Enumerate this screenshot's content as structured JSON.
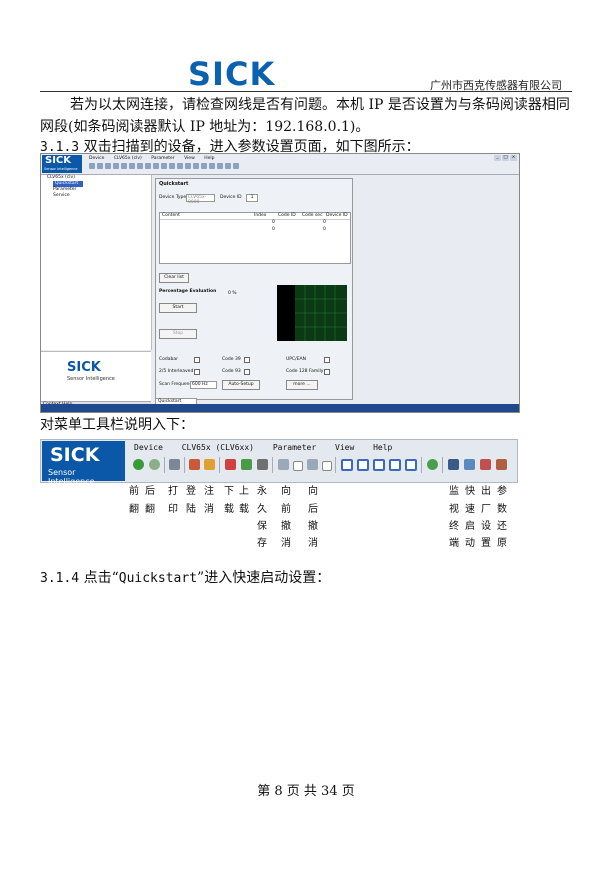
{
  "header": {
    "logo": "SICK",
    "company": "广州市西克传感器有限公司"
  },
  "body": {
    "para1": "若为以太网连接，请检查网线是否有问题。本机 IP 是否设置为与条码阅读器相同网段(如条码阅读器默认 IP 地址为：192.168.0.1)。",
    "sec313_num": "3.1.3",
    "sec313_text": " 双击扫描到的设备，进入参数设置页面，如下图所示：",
    "menu_intro": "对菜单工具栏说明入下：",
    "sec314_num": "3.1.4",
    "sec314_text_a": " 点击“",
    "sec314_mono": "Quickstart",
    "sec314_text_b": "”进入快速启动设置："
  },
  "screenshot": {
    "logo": "SICK",
    "logo_sub": "Sensor Intelligence",
    "menus": [
      "Device",
      "CLV65x (clv)",
      "Parameter",
      "View",
      "Help"
    ],
    "tree": [
      "CLV65x (clv)",
      "Quickstart",
      "Parameter",
      "Service"
    ],
    "panel_title": "Quickstart",
    "device_type_label": "Device Type",
    "device_type_value": "CLV65x-0000",
    "device_id_label": "Device ID",
    "device_id_value": "1",
    "grid_headers": [
      "Content",
      "Index",
      "Code ID",
      "Code sec",
      "Device ID"
    ],
    "grid_rows": [
      [
        "",
        "",
        "0",
        "",
        "0"
      ],
      [
        "",
        "",
        "0",
        "",
        "0"
      ]
    ],
    "clear_list": "Clear list",
    "percentage_eval": "Percentage Evaluation",
    "percent_value": "0 %",
    "start": "Start",
    "stop": "Stop",
    "codes": [
      "Codabar",
      "Code 39",
      "UPC/EAN",
      "2/5 Interleaved",
      "Code 93",
      "Code 128 Family"
    ],
    "scan_freq_label": "Scan Frequency",
    "scan_freq_value": "600 Hz",
    "auto_setup": "Auto-Setup",
    "more": "more ...",
    "context_help": "Context Help",
    "quickstart_tab": "Quickstart"
  },
  "menubar": {
    "logo": "SICK",
    "logo_sub": "Sensor Intelligence.",
    "menus": [
      "Device",
      "CLV65x (CLV6xx)",
      "Parameter",
      "View",
      "Help"
    ]
  },
  "labels": [
    [
      "前",
      "翻"
    ],
    [
      "后",
      "翻"
    ],
    [
      "打",
      "印"
    ],
    [
      "登",
      "陆"
    ],
    [
      "注",
      "消"
    ],
    [
      "下",
      "载"
    ],
    [
      "上",
      "载"
    ],
    [
      "永",
      "久",
      "保",
      "存"
    ],
    [
      "向",
      "前",
      "撤",
      "消"
    ],
    [
      "向",
      "后",
      "撤",
      "消"
    ],
    [
      "监",
      "视",
      "终",
      "端"
    ],
    [
      "快",
      "速",
      "启",
      "动"
    ],
    [
      "出",
      "厂",
      "设",
      "置"
    ],
    [
      "参",
      "数",
      "还",
      "原"
    ]
  ],
  "footer": "第 8 页 共 34 页"
}
